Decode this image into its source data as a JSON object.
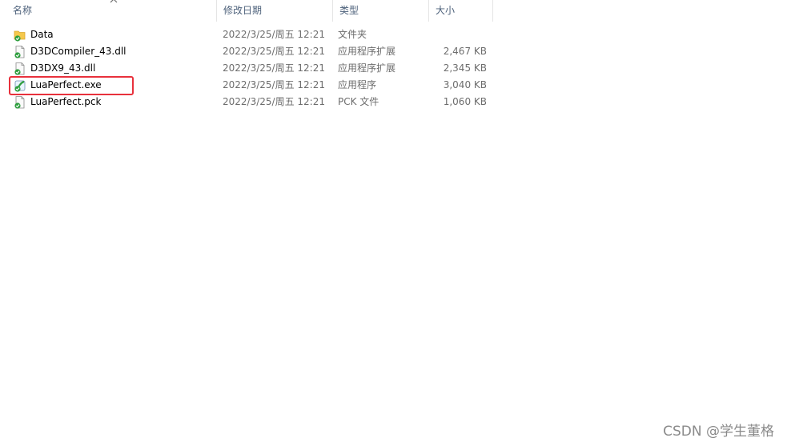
{
  "columns": {
    "name": "名称",
    "date_modified": "修改日期",
    "type": "类型",
    "size": "大小"
  },
  "files": [
    {
      "name": "Data",
      "date": "2022/3/25/周五 12:21",
      "type": "文件夹",
      "size": "",
      "icon": "folder-icon"
    },
    {
      "name": "D3DCompiler_43.dll",
      "date": "2022/3/25/周五 12:21",
      "type": "应用程序扩展",
      "size": "2,467 KB",
      "icon": "dll-file-icon"
    },
    {
      "name": "D3DX9_43.dll",
      "date": "2022/3/25/周五 12:21",
      "type": "应用程序扩展",
      "size": "2,345 KB",
      "icon": "dll-file-icon"
    },
    {
      "name": "LuaPerfect.exe",
      "date": "2022/3/25/周五 12:21",
      "type": "应用程序",
      "size": "3,040 KB",
      "icon": "exe-file-icon"
    },
    {
      "name": "LuaPerfect.pck",
      "date": "2022/3/25/周五 12:21",
      "type": "PCK 文件",
      "size": "1,060 KB",
      "icon": "pck-file-icon"
    }
  ],
  "highlight_color": "#e8313c",
  "watermark": "CSDN @学生董格"
}
